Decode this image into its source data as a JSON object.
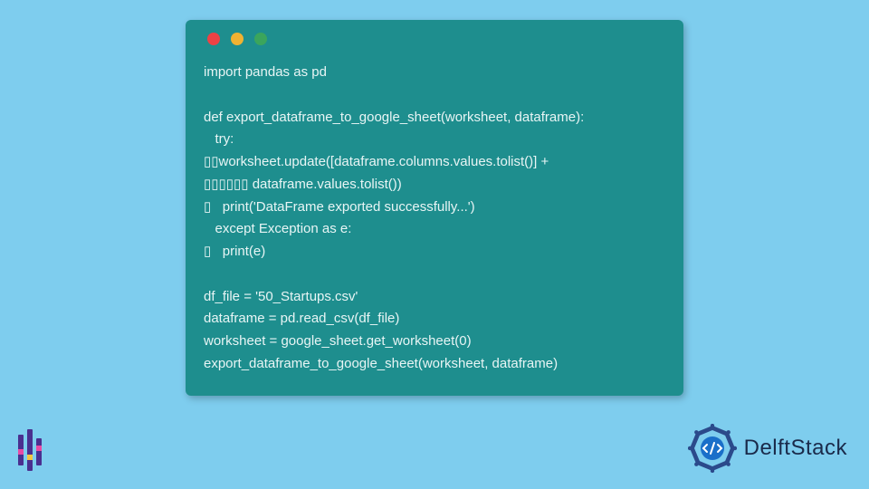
{
  "code": {
    "lines": [
      "import pandas as pd",
      "",
      "def export_dataframe_to_google_sheet(worksheet, dataframe):",
      "   try:",
      "▯▯worksheet.update([dataframe.columns.values.tolist()] +",
      "▯▯▯▯▯▯ dataframe.values.tolist())",
      "▯   print('DataFrame exported successfully...')",
      "   except Exception as e:",
      "▯   print(e)",
      "",
      "df_file = '50_Startups.csv'",
      "dataframe = pd.read_csv(df_file)",
      "worksheet = google_sheet.get_worksheet(0)",
      "export_dataframe_to_google_sheet(worksheet, dataframe)"
    ]
  },
  "brand": {
    "name": "DelftStack"
  },
  "colors": {
    "bg": "#7ecdee",
    "card": "#1e8e8e",
    "logo_primary": "#2b4a8b",
    "logo_accent": "#1a6fc9"
  }
}
